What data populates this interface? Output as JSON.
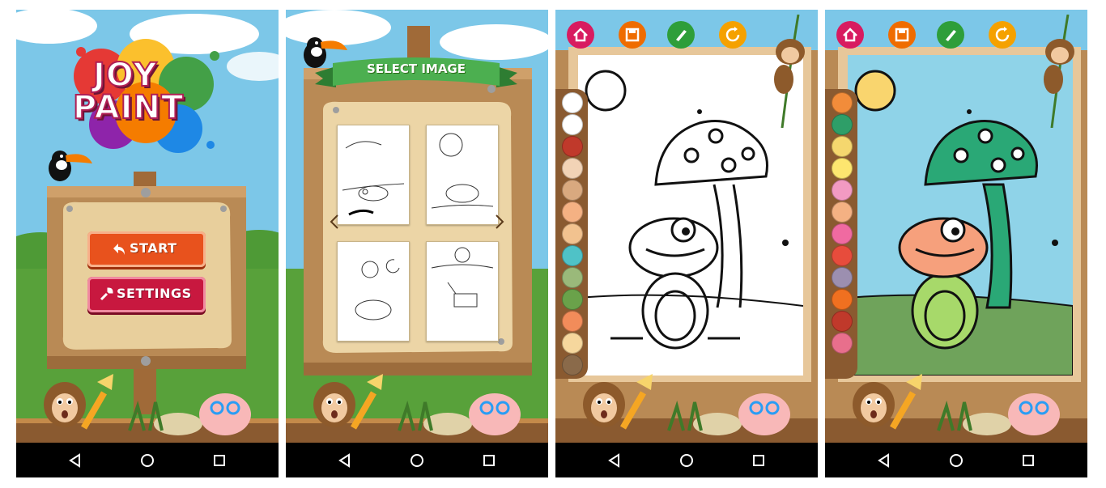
{
  "app": {
    "logo_line1": "JOY",
    "logo_line2": "PAINT",
    "start_label": "START",
    "settings_label": "SETTINGS",
    "select_title": "SELECT IMAGE"
  },
  "nav_icons": [
    "back-icon",
    "home-icon",
    "recent-apps-icon"
  ],
  "toolbar_icons": [
    "home-icon",
    "save-icon",
    "brush-icon",
    "refresh-icon"
  ],
  "colors": {
    "sky": "#7cc7e8",
    "grass": "#58a13a",
    "wood": "#b98a55",
    "start_button": "#e8521d",
    "settings_button": "#c8183f",
    "home_button": "#d81b60",
    "save_button": "#ef6c00",
    "brush_button": "#2e9e3a",
    "refresh_button": "#f5a100"
  },
  "palette_blank": [
    "#ffffff",
    "#ffffff",
    "#c0392b",
    "#f2d3b6",
    "#d9a97f",
    "#f4b183",
    "#f2c28f",
    "#4fc2c7",
    "#9ab97a",
    "#6aa24a",
    "#f28c5a",
    "#f6d79d",
    "#8a6a4a"
  ],
  "palette_colored": [
    "#f28c3a",
    "#2e9e68",
    "#f5d76e",
    "#fde66f",
    "#f29ac2",
    "#f4b183",
    "#f06aa1",
    "#e74c3c",
    "#9c8fb0",
    "#f07020",
    "#c0392b",
    "#e86f8c"
  ],
  "filled_colors": {
    "sun": "#f9d56e",
    "background": "#8fd3e8",
    "mushroom": "#2aa876",
    "frog_head": "#f6a07c",
    "frog_body": "#a7d96a",
    "ground": "#6fa35b"
  }
}
